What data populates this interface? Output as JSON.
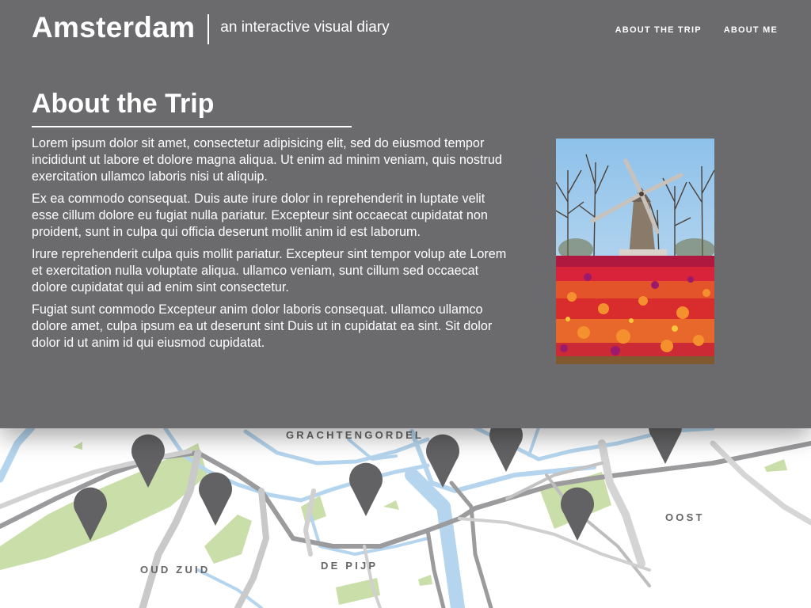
{
  "header": {
    "brand_title": "Amsterdam",
    "tagline": "an interactive visual diary",
    "nav": [
      {
        "label": "ABOUT THE TRIP"
      },
      {
        "label": "ABOUT ME"
      }
    ]
  },
  "panel": {
    "title": "About the Trip",
    "paragraphs": [
      "Lorem ipsum dolor sit amet, consectetur adipisicing elit, sed do eiusmod tempor incididunt ut labore et dolore magna aliqua. Ut enim ad minim veniam, quis nostrud exercitation ullamco laboris nisi ut aliquip.",
      "Ex ea commodo consequat. Duis aute irure dolor in reprehenderit in luptate velit esse cillum dolore eu fugiat nulla pariatur. Excepteur sint occaecat cupidatat non proident, sunt in culpa qui officia deserunt mollit anim id est laborum.",
      "Irure reprehenderit culpa quis mollit pariatur. Excepteur sint tempor volup ate Lorem et exercitation nulla voluptate aliqua. ullamco veniam, sunt cillum sed occaecat dolore cupidatat qui ad enim sint consectetur.",
      "Fugiat sunt commodo Excepteur anim dolor laboris consequat. ullamco ullamco dolore amet, culpa ipsum ea ut deserunt sint Duis ut in cupidatat ea sint. Sit dolor dolor id ut anim id qui eiusmod cupidatat."
    ]
  },
  "map": {
    "districts": [
      "GRACHTENGORDEL",
      "OOST",
      "OUD ZUID",
      "DE PIJP"
    ],
    "pin_icon": "map-pin-icon"
  },
  "colors": {
    "overlay": "#6b6b6e",
    "water": "#b3d4ee",
    "park": "#c7dca5",
    "road": "#c8c8c8",
    "pin": "#626264"
  }
}
